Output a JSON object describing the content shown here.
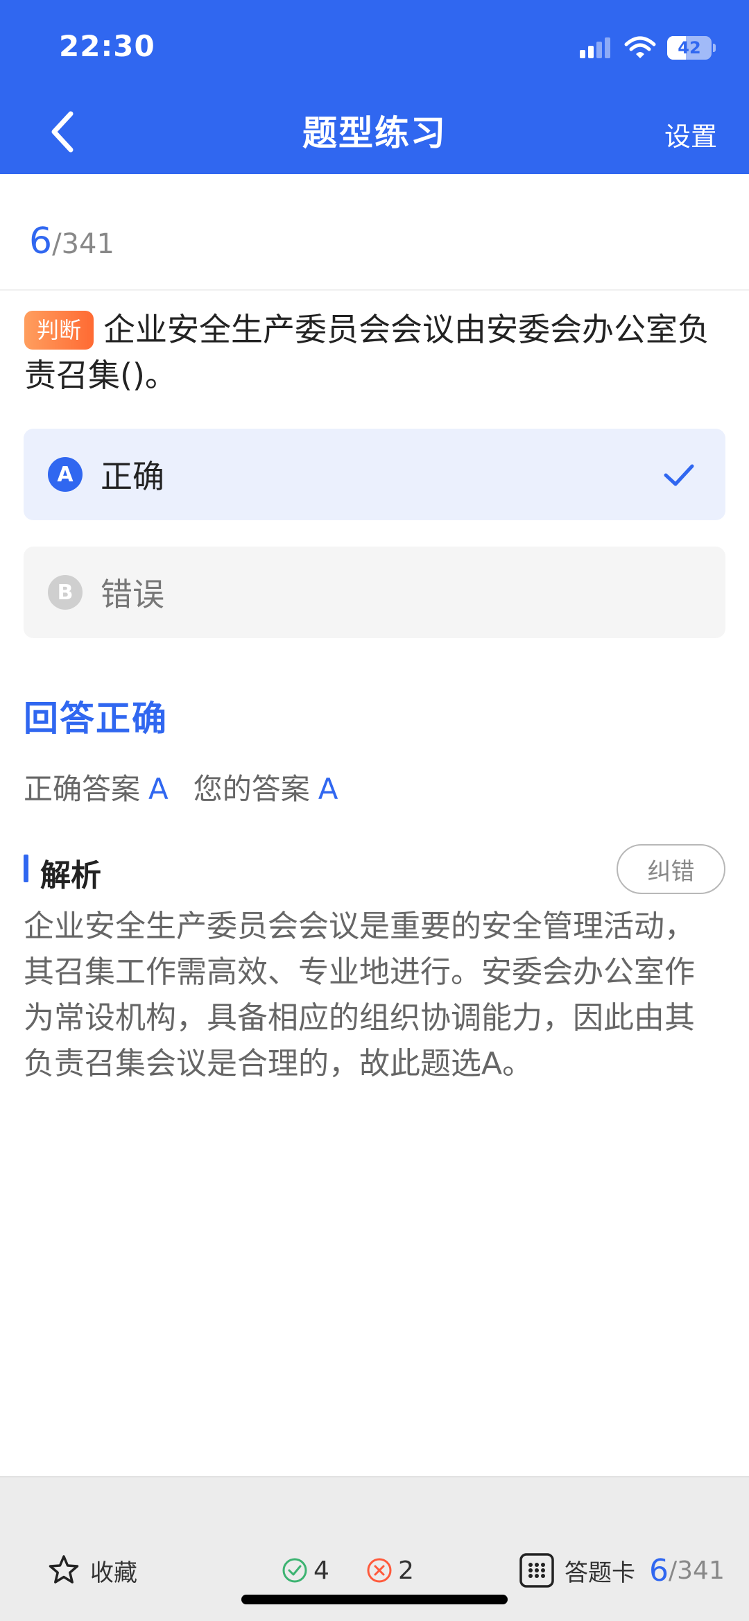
{
  "status_bar": {
    "time": "22:30",
    "battery": "42",
    "battery_level": 0.42
  },
  "header": {
    "title": "题型练习",
    "settings_label": "设置"
  },
  "progress": {
    "current": "6",
    "total": "/341"
  },
  "question": {
    "type_tag": "判断",
    "text": "企业安全生产委员会会议由安委会办公室负责召集()。"
  },
  "options": [
    {
      "letter": "A",
      "text": "正确",
      "selected": true
    },
    {
      "letter": "B",
      "text": "错误",
      "selected": false
    }
  ],
  "result": {
    "title": "回答正确",
    "correct_label": "正确答案",
    "correct_value": "A",
    "your_label": "您的答案",
    "your_value": "A"
  },
  "analysis": {
    "title": "解析",
    "report_label": "纠错",
    "text": "企业安全生产委员会会议是重要的安全管理活动，其召集工作需高效、专业地进行。安委会办公室作为常设机构，具备相应的组织协调能力，因此由其负责召集会议是合理的，故此题选A。"
  },
  "bottom_bar": {
    "favorite_label": "收藏",
    "correct_count": "4",
    "wrong_count": "2",
    "answer_card_label": "答题卡",
    "progress_current": "6",
    "progress_total": "/341"
  },
  "colors": {
    "accent": "#3067f0",
    "tag_orange": "#ff7a3d",
    "correct_green": "#3cb371",
    "wrong_red": "#ff5a3c"
  },
  "icons": [
    "back-arrow-icon",
    "signal-icon",
    "wifi-icon",
    "battery-icon",
    "check-icon",
    "star-icon",
    "check-circle-icon",
    "cross-circle-icon",
    "grid-icon"
  ]
}
